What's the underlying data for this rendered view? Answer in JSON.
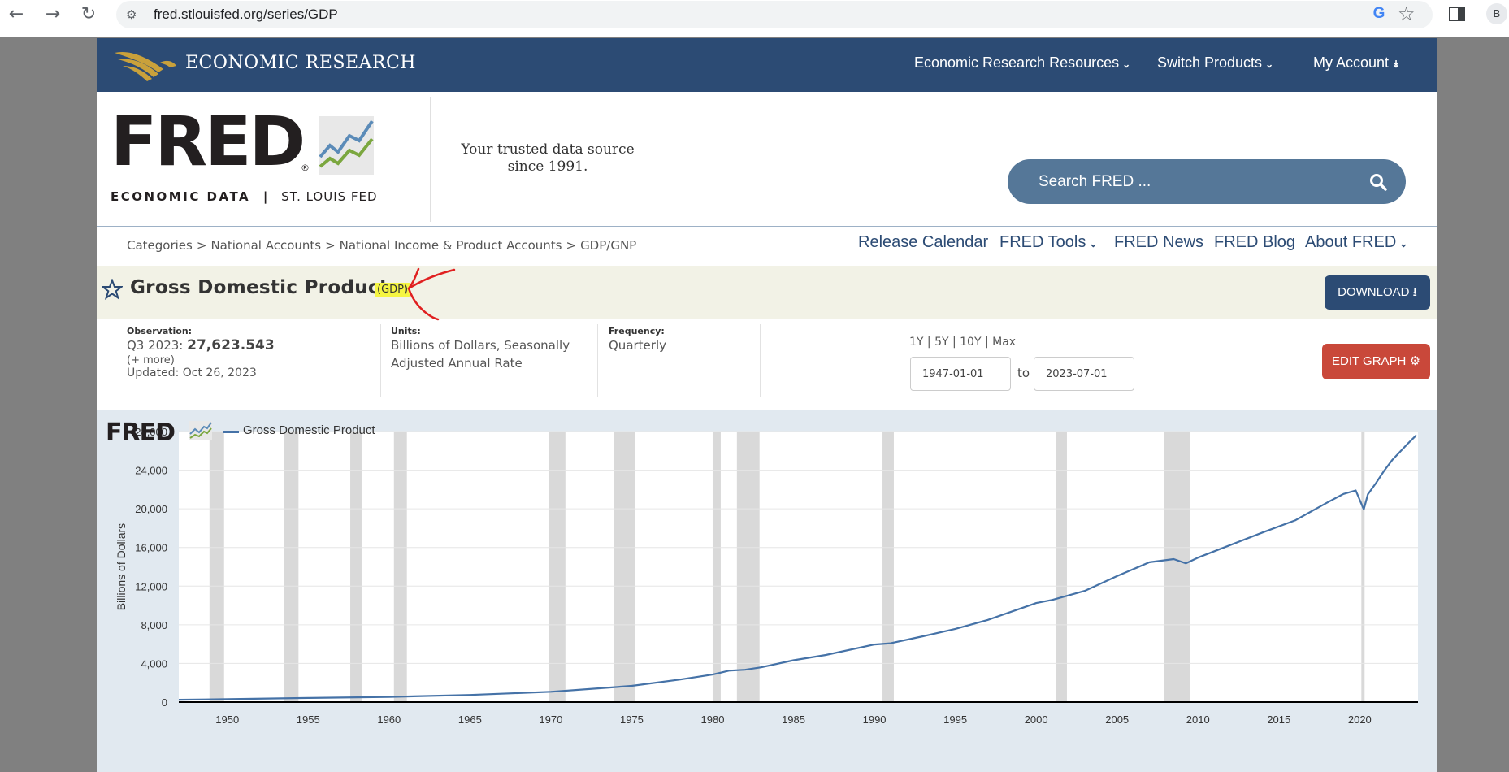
{
  "browser": {
    "url": "fred.stlouisfed.org/series/GDP",
    "profile_initial": "B"
  },
  "header": {
    "org_title": "ECONOMIC RESEARCH",
    "nav": [
      {
        "label": "Economic Research Resources"
      },
      {
        "label": "Switch Products"
      },
      {
        "label": "My Account"
      }
    ],
    "colors": {
      "header_bg": "#2c4b74",
      "accent_gold": "#c9a13b"
    }
  },
  "brand": {
    "wordmark": "FRED",
    "reg": "®",
    "subtitle_left": "ECONOMIC DATA",
    "subtitle_sep": "|",
    "subtitle_right": "ST. LOUIS FED",
    "tagline": "Your trusted data source since 1991.",
    "search_placeholder": "Search FRED ...",
    "secondary_nav": [
      {
        "label": "Release Calendar"
      },
      {
        "label": "FRED Tools"
      },
      {
        "label": "FRED News"
      },
      {
        "label": "FRED Blog"
      },
      {
        "label": "About FRED"
      }
    ]
  },
  "breadcrumb": [
    "Categories",
    "National Accounts",
    "National Income & Product Accounts",
    "GDP/GNP"
  ],
  "series": {
    "title": "Gross Domestic Product",
    "id": "(GDP)",
    "download_label": "DOWNLOAD",
    "edit_graph_label": "EDIT GRAPH"
  },
  "meta": {
    "observation_label": "Observation:",
    "observation_period": "Q3 2023:",
    "observation_value": "27,623.543",
    "more": "(+ more)",
    "updated": "Updated: Oct 26, 2023",
    "units_label": "Units:",
    "units_value": "Billions of Dollars, Seasonally Adjusted Annual Rate",
    "frequency_label": "Frequency:",
    "frequency_value": "Quarterly",
    "range_links": "1Y | 5Y | 10Y | Max",
    "start_date": "1947-01-01",
    "to_label": "to",
    "end_date": "2023-07-01"
  },
  "chart_data": {
    "type": "line",
    "title": "",
    "logo": "FRED",
    "ylabel": "Billions of Dollars",
    "xlabel": "",
    "xlim": [
      1947.0,
      2023.6
    ],
    "ylim": [
      0,
      28000
    ],
    "yticks": [
      0,
      4000,
      8000,
      12000,
      16000,
      20000,
      24000,
      28000
    ],
    "ytick_labels": [
      "0",
      "4,000",
      "8,000",
      "12,000",
      "16,000",
      "20,000",
      "24,000",
      "28,000"
    ],
    "xticks": [
      1950,
      1955,
      1960,
      1965,
      1970,
      1975,
      1980,
      1985,
      1990,
      1995,
      2000,
      2005,
      2010,
      2015,
      2020
    ],
    "xtick_labels": [
      "1950",
      "1955",
      "1960",
      "1965",
      "1970",
      "1975",
      "1980",
      "1985",
      "1990",
      "1995",
      "2000",
      "2005",
      "2010",
      "2015",
      "2020"
    ],
    "grid": true,
    "legend_position": "top-left",
    "recession_shading_color": "#d9d9d9",
    "recessions": [
      [
        1948.9,
        1949.8
      ],
      [
        1953.5,
        1954.4
      ],
      [
        1957.6,
        1958.3
      ],
      [
        1960.3,
        1961.1
      ],
      [
        1969.9,
        1970.9
      ],
      [
        1973.9,
        1975.2
      ],
      [
        1980.0,
        1980.5
      ],
      [
        1981.5,
        1982.9
      ],
      [
        1990.5,
        1991.2
      ],
      [
        2001.2,
        2001.9
      ],
      [
        2007.9,
        2009.5
      ],
      [
        2020.1,
        2020.3
      ]
    ],
    "series": [
      {
        "name": "Gross Domestic Product",
        "color": "#4572a7",
        "x": [
          1947,
          1950,
          1955,
          1960,
          1965,
          1970,
          1973,
          1975,
          1978,
          1980,
          1981,
          1982,
          1983,
          1985,
          1987,
          1990,
          1991,
          1993,
          1995,
          1997,
          2000,
          2001,
          2003,
          2005,
          2007,
          2008.5,
          2009.25,
          2010,
          2012,
          2014,
          2016,
          2018,
          2019,
          2019.75,
          2020.25,
          2020.5,
          2021,
          2021.5,
          2022,
          2023,
          2023.5
        ],
        "y": [
          244,
          300,
          430,
          540,
          740,
          1070,
          1430,
          1680,
          2340,
          2850,
          3250,
          3350,
          3600,
          4330,
          4880,
          5960,
          6090,
          6810,
          7580,
          8500,
          10250,
          10580,
          11510,
          13040,
          14470,
          14800,
          14360,
          14950,
          16250,
          17560,
          18800,
          20660,
          21540,
          21900,
          19940,
          21500,
          22650,
          23920,
          25030,
          26800,
          27620
        ]
      }
    ]
  }
}
